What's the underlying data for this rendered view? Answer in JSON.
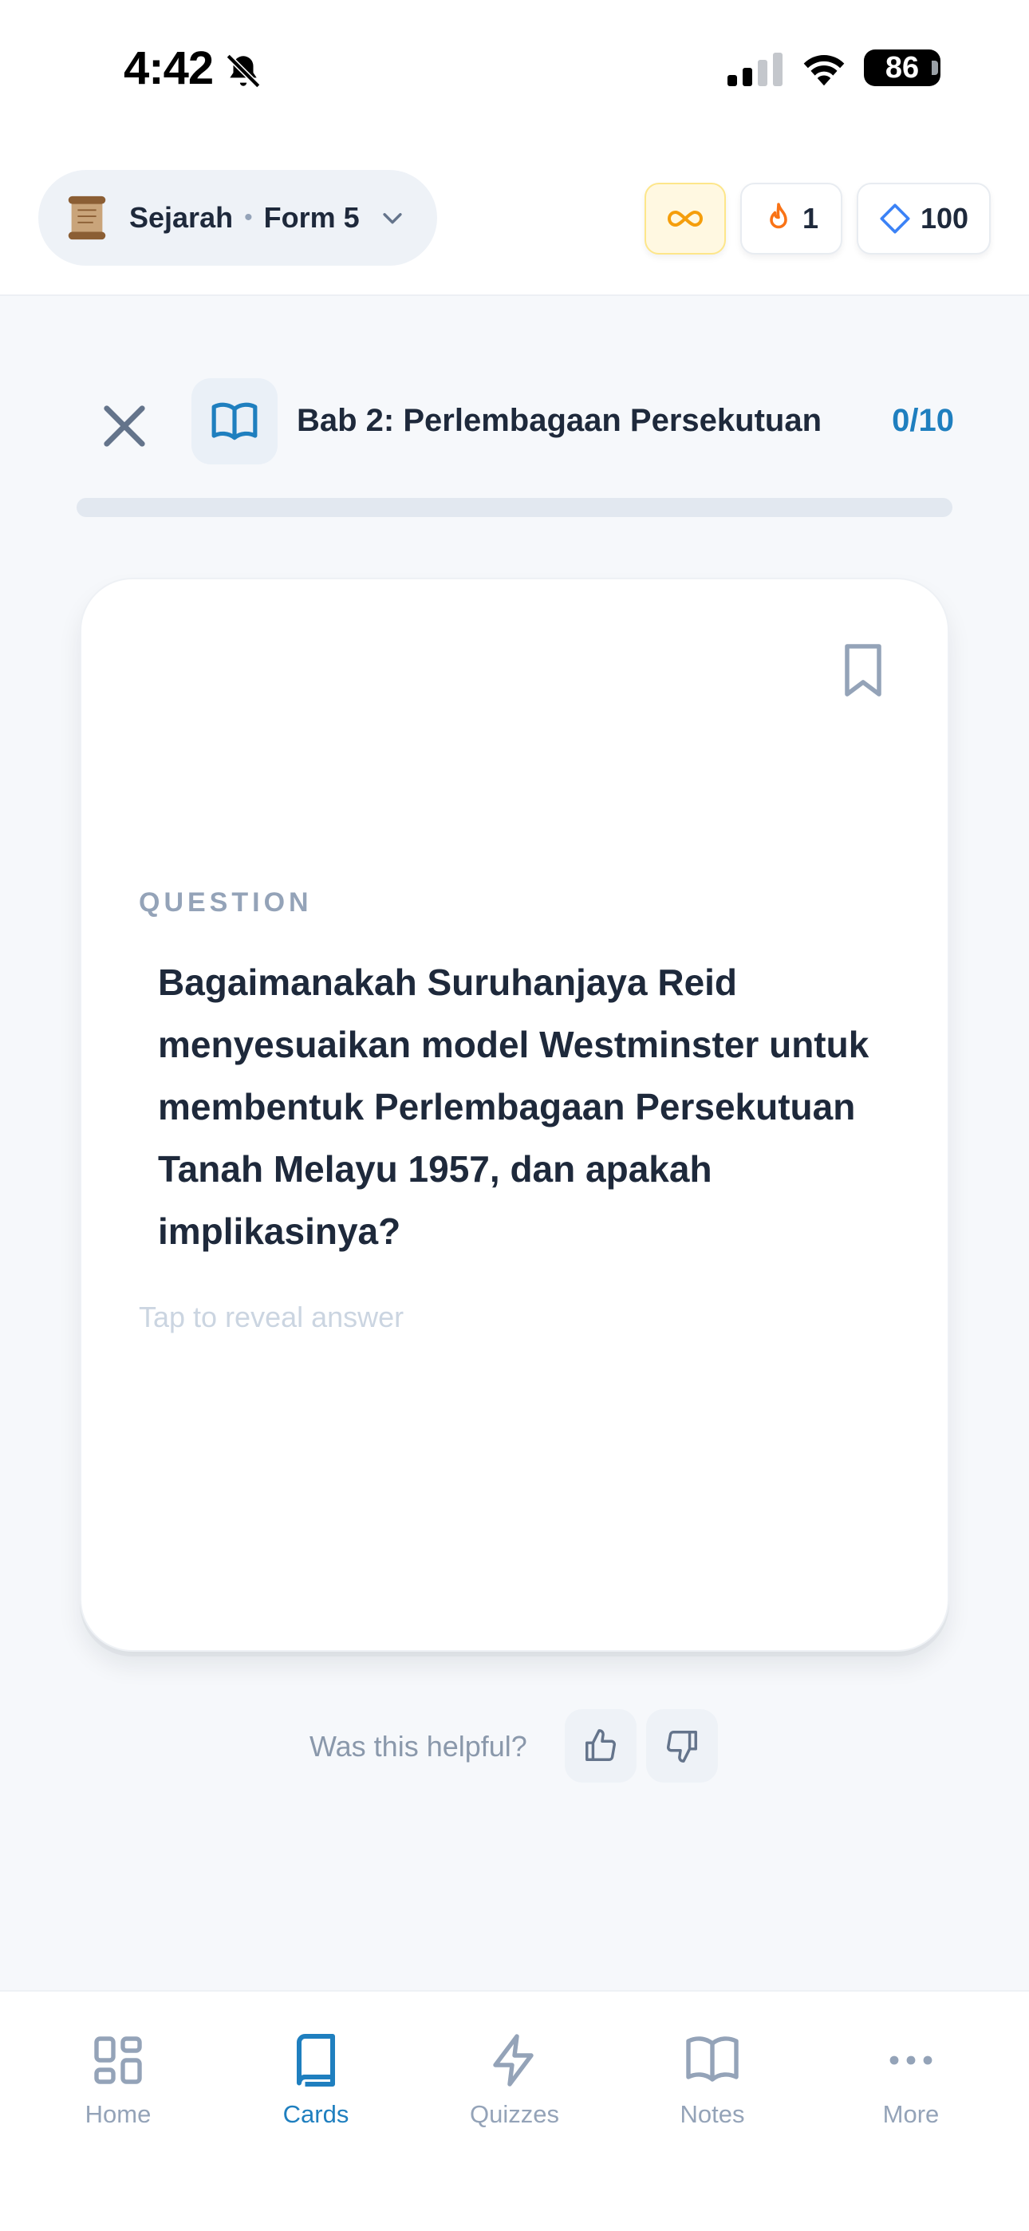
{
  "status_bar": {
    "time": "4:42",
    "battery": "86"
  },
  "header": {
    "subject": "Sejarah",
    "separator": "•",
    "form": "Form 5",
    "streak": "1",
    "gems": "100"
  },
  "session": {
    "chapter_title": "Bab 2: Perlembagaan Persekutuan",
    "progress_label": "0/10",
    "progress_fraction": 0.0
  },
  "card": {
    "label": "QUESTION",
    "question": "Bagaimanakah Suruhanjaya Reid menyesuaikan model Westminster untuk membentuk Perlembagaan Persekutuan Tanah Melayu 1957, dan apakah implikasinya?",
    "hint": "Tap to reveal answer"
  },
  "feedback": {
    "prompt": "Was this helpful?"
  },
  "nav": {
    "items": [
      {
        "label": "Home",
        "icon": "grid-icon",
        "active": false
      },
      {
        "label": "Cards",
        "icon": "book-icon",
        "active": true
      },
      {
        "label": "Quizzes",
        "icon": "lightning-icon",
        "active": false
      },
      {
        "label": "Notes",
        "icon": "open-book-icon",
        "active": false
      },
      {
        "label": "More",
        "icon": "dots-icon",
        "active": false
      }
    ]
  },
  "colors": {
    "accent": "#1f7fbf",
    "text_primary": "#1e293b",
    "muted": "#94a3b8",
    "streak": "#f97316",
    "infinity": "#f59e0b",
    "gem": "#3b82f6"
  }
}
